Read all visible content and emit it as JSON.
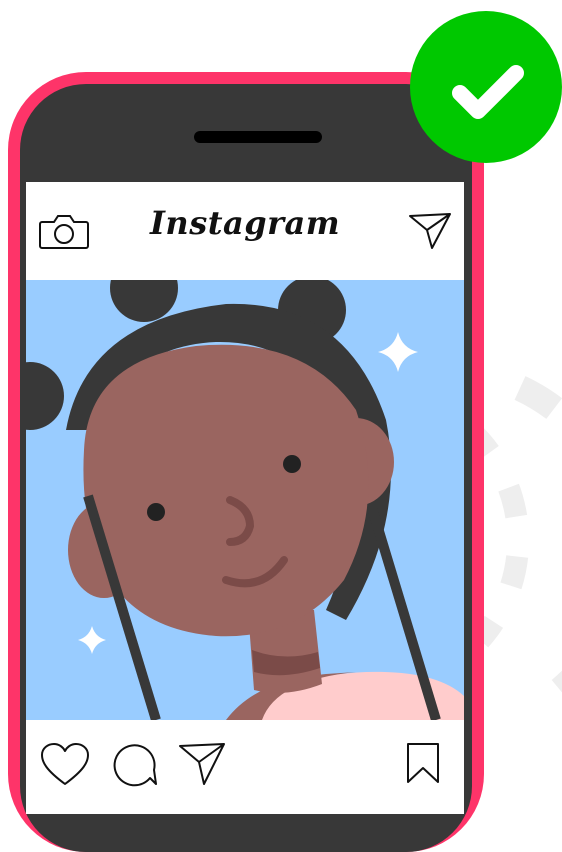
{
  "app": {
    "title": "Instagram"
  },
  "header": {
    "left_icon": "camera-icon",
    "right_icon": "paper-plane-icon"
  },
  "post": {
    "image_icon": "illustrated-portrait"
  },
  "actions": {
    "icons": [
      "heart-icon",
      "comment-icon",
      "share-icon",
      "bookmark-icon"
    ]
  },
  "badge": {
    "icon": "checkmark-icon",
    "color": "#00c800"
  },
  "colors": {
    "phone_frame": "#fe3469",
    "phone_body": "#383838",
    "post_background": "#99ccff",
    "skin": "#9a6560",
    "hair": "#383838",
    "shirt": "#ffcccc"
  }
}
